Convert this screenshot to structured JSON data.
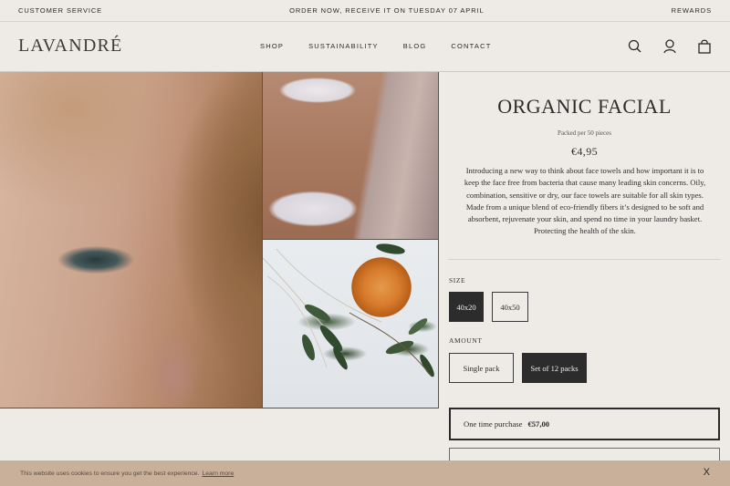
{
  "topbar": {
    "customer_service": "CUSTOMER SERVICE",
    "promo": "ORDER NOW, RECEIVE IT  ON TUESDAY 07 APRIL",
    "rewards": "REWARDS"
  },
  "header": {
    "logo": "LAVANDRÉ",
    "nav": [
      "SHOP",
      "SUSTAINABILITY",
      "BLOG",
      "CONTACT"
    ],
    "icons": [
      "search-icon",
      "account-icon",
      "bag-icon"
    ]
  },
  "product": {
    "title": "ORGANIC FACIAL",
    "packing": "Packed per 50 pieces",
    "price": "€4,95",
    "description": "Introducing a new way to think about face towels and how important it is to keep the face free from bacteria that cause many leading skin concerns. Oily, combination, sensitive or dry, our face towels are suitable for all skin types. Made from a unique blend of eco-friendly fibers it’s designed to be soft and absorbent, rejuvenate your skin, and spend no time in your laundry basket. Protecting the health of the skin.",
    "size_label": "SIZE",
    "sizes": [
      "40x20",
      "40x50"
    ],
    "selected_size": "40x20",
    "amount_label": "AMOUNT",
    "amounts": [
      "Single pack",
      "Set of 12 packs"
    ],
    "selected_amount": "Set of 12 packs",
    "purchase_label": "One time purchase",
    "purchase_price": "€57,00"
  },
  "cookie": {
    "text": "This website uses cookies to ensure you get the best experience.",
    "link": "Learn more",
    "close": "X"
  },
  "colors": {
    "background": "#eeeae6",
    "selected_option": "#2c2c2c",
    "cookie_bar": "#c9b09a"
  }
}
